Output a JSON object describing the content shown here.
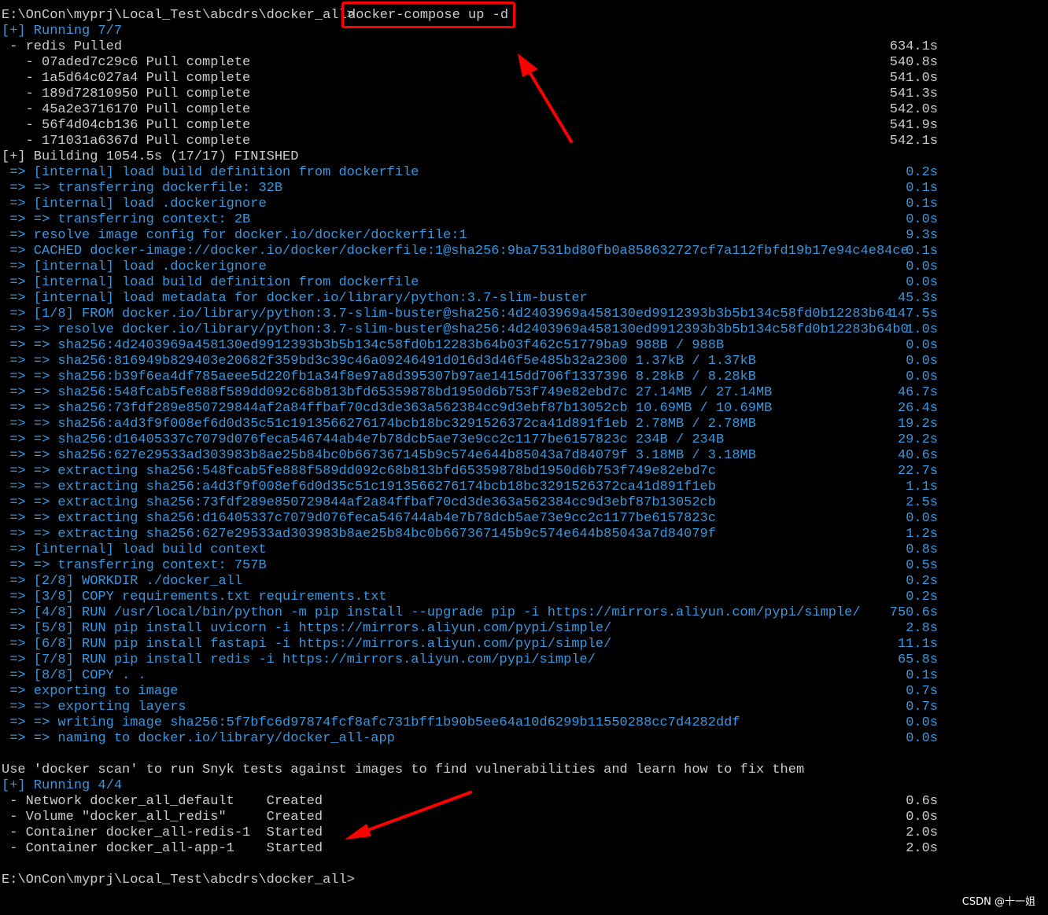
{
  "terminal": {
    "prompt_path": "E:\\OnCon\\myprj\\Local_Test\\abcdrs\\docker_all>",
    "command": "docker-compose up -d",
    "lines": [
      {
        "text": "[+] Running 7/7",
        "time": "",
        "color": "b"
      },
      {
        "text": " - redis Pulled",
        "time": "634.1s",
        "color": "w"
      },
      {
        "text": "   - 07aded7c29c6 Pull complete",
        "time": "540.8s",
        "color": "w"
      },
      {
        "text": "   - 1a5d64c027a4 Pull complete",
        "time": "541.0s",
        "color": "w"
      },
      {
        "text": "   - 189d72810950 Pull complete",
        "time": "541.3s",
        "color": "w"
      },
      {
        "text": "   - 45a2e3716170 Pull complete",
        "time": "542.0s",
        "color": "w"
      },
      {
        "text": "   - 56f4d04cb136 Pull complete",
        "time": "541.9s",
        "color": "w"
      },
      {
        "text": "   - 171031a6367d Pull complete",
        "time": "542.1s",
        "color": "w"
      },
      {
        "text": "[+] Building 1054.5s (17/17) FINISHED",
        "time": "",
        "color": "w"
      },
      {
        "text": " => [internal] load build definition from dockerfile",
        "time": "0.2s",
        "color": "b"
      },
      {
        "text": " => => transferring dockerfile: 32B",
        "time": "0.1s",
        "color": "b"
      },
      {
        "text": " => [internal] load .dockerignore",
        "time": "0.1s",
        "color": "b"
      },
      {
        "text": " => => transferring context: 2B",
        "time": "0.0s",
        "color": "b"
      },
      {
        "text": " => resolve image config for docker.io/docker/dockerfile:1",
        "time": "9.3s",
        "color": "b"
      },
      {
        "text": " => CACHED docker-image://docker.io/docker/dockerfile:1@sha256:9ba7531bd80fb0a858632727cf7a112fbfd19b17e94c4e84ce",
        "time": "0.1s",
        "color": "b"
      },
      {
        "text": " => [internal] load .dockerignore",
        "time": "0.0s",
        "color": "b"
      },
      {
        "text": " => [internal] load build definition from dockerfile",
        "time": "0.0s",
        "color": "b"
      },
      {
        "text": " => [internal] load metadata for docker.io/library/python:3.7-slim-buster",
        "time": "45.3s",
        "color": "b"
      },
      {
        "text": " => [1/8] FROM docker.io/library/python:3.7-slim-buster@sha256:4d2403969a458130ed9912393b3b5b134c58fd0b12283b64",
        "time": "147.5s",
        "color": "b"
      },
      {
        "text": " => => resolve docker.io/library/python:3.7-slim-buster@sha256:4d2403969a458130ed9912393b3b5b134c58fd0b12283b64b0",
        "time": "1.0s",
        "color": "b"
      },
      {
        "text": " => => sha256:4d2403969a458130ed9912393b3b5b134c58fd0b12283b64b03f462c51779ba9 988B / 988B",
        "time": "0.0s",
        "color": "b"
      },
      {
        "text": " => => sha256:816949b829403e20682f359bd3c39c46a09246491d016d3d46f5e485b32a2300 1.37kB / 1.37kB",
        "time": "0.0s",
        "color": "b"
      },
      {
        "text": " => => sha256:b39f6ea4df785aeee5d220fb1a34f8e97a8d395307b97ae1415dd706f1337396 8.28kB / 8.28kB",
        "time": "0.0s",
        "color": "b"
      },
      {
        "text": " => => sha256:548fcab5fe888f589dd092c68b813bfd65359878bd1950d6b753f749e82ebd7c 27.14MB / 27.14MB",
        "time": "46.7s",
        "color": "b"
      },
      {
        "text": " => => sha256:73fdf289e850729844af2a84ffbaf70cd3de363a562384cc9d3ebf87b13052cb 10.69MB / 10.69MB",
        "time": "26.4s",
        "color": "b"
      },
      {
        "text": " => => sha256:a4d3f9f008ef6d0d35c51c1913566276174bcb18bc3291526372ca41d891f1eb 2.78MB / 2.78MB",
        "time": "19.2s",
        "color": "b"
      },
      {
        "text": " => => sha256:d16405337c7079d076feca546744ab4e7b78dcb5ae73e9cc2c1177be6157823c 234B / 234B",
        "time": "29.2s",
        "color": "b"
      },
      {
        "text": " => => sha256:627e29533ad303983b8ae25b84bc0b667367145b9c574e644b85043a7d84079f 3.18MB / 3.18MB",
        "time": "40.6s",
        "color": "b"
      },
      {
        "text": " => => extracting sha256:548fcab5fe888f589dd092c68b813bfd65359878bd1950d6b753f749e82ebd7c",
        "time": "22.7s",
        "color": "b"
      },
      {
        "text": " => => extracting sha256:a4d3f9f008ef6d0d35c51c1913566276174bcb18bc3291526372ca41d891f1eb",
        "time": "1.1s",
        "color": "b"
      },
      {
        "text": " => => extracting sha256:73fdf289e850729844af2a84ffbaf70cd3de363a562384cc9d3ebf87b13052cb",
        "time": "2.5s",
        "color": "b"
      },
      {
        "text": " => => extracting sha256:d16405337c7079d076feca546744ab4e7b78dcb5ae73e9cc2c1177be6157823c",
        "time": "0.0s",
        "color": "b"
      },
      {
        "text": " => => extracting sha256:627e29533ad303983b8ae25b84bc0b667367145b9c574e644b85043a7d84079f",
        "time": "1.2s",
        "color": "b"
      },
      {
        "text": " => [internal] load build context",
        "time": "0.8s",
        "color": "b"
      },
      {
        "text": " => => transferring context: 757B",
        "time": "0.5s",
        "color": "b"
      },
      {
        "text": " => [2/8] WORKDIR ./docker_all",
        "time": "0.2s",
        "color": "b"
      },
      {
        "text": " => [3/8] COPY requirements.txt requirements.txt",
        "time": "0.2s",
        "color": "b"
      },
      {
        "text": " => [4/8] RUN /usr/local/bin/python -m pip install --upgrade pip -i https://mirrors.aliyun.com/pypi/simple/",
        "time": "750.6s",
        "color": "b"
      },
      {
        "text": " => [5/8] RUN pip install uvicorn -i https://mirrors.aliyun.com/pypi/simple/",
        "time": "2.8s",
        "color": "b"
      },
      {
        "text": " => [6/8] RUN pip install fastapi -i https://mirrors.aliyun.com/pypi/simple/",
        "time": "11.1s",
        "color": "b"
      },
      {
        "text": " => [7/8] RUN pip install redis -i https://mirrors.aliyun.com/pypi/simple/",
        "time": "65.8s",
        "color": "b"
      },
      {
        "text": " => [8/8] COPY . .",
        "time": "0.1s",
        "color": "b"
      },
      {
        "text": " => exporting to image",
        "time": "0.7s",
        "color": "b"
      },
      {
        "text": " => => exporting layers",
        "time": "0.7s",
        "color": "b"
      },
      {
        "text": " => => writing image sha256:5f7bfc6d97874fcf8afc731bff1b90b5ee64a10d6299b11550288cc7d4282ddf",
        "time": "0.0s",
        "color": "b"
      },
      {
        "text": " => => naming to docker.io/library/docker_all-app",
        "time": "0.0s",
        "color": "b"
      },
      {
        "text": "",
        "time": "",
        "color": "w"
      },
      {
        "text": "Use 'docker scan' to run Snyk tests against images to find vulnerabilities and learn how to fix them",
        "time": "",
        "color": "w"
      },
      {
        "text": "[+] Running 4/4",
        "time": "",
        "color": "b"
      },
      {
        "text": " - Network docker_all_default    Created",
        "time": "0.6s",
        "color": "w"
      },
      {
        "text": " - Volume \"docker_all_redis\"     Created",
        "time": "0.0s",
        "color": "w"
      },
      {
        "text": " - Container docker_all-redis-1  Started",
        "time": "2.0s",
        "color": "w"
      },
      {
        "text": " - Container docker_all-app-1    Started",
        "time": "2.0s",
        "color": "w"
      },
      {
        "text": "",
        "time": "",
        "color": "w"
      },
      {
        "text": "E:\\OnCon\\myprj\\Local_Test\\abcdrs\\docker_all>",
        "time": "",
        "color": "w"
      }
    ]
  },
  "watermark": "CSDN @十一姐",
  "colors": {
    "background": "#000000",
    "text": "#cccccc",
    "blue": "#3a96dd",
    "annotation": "#ff0000"
  }
}
